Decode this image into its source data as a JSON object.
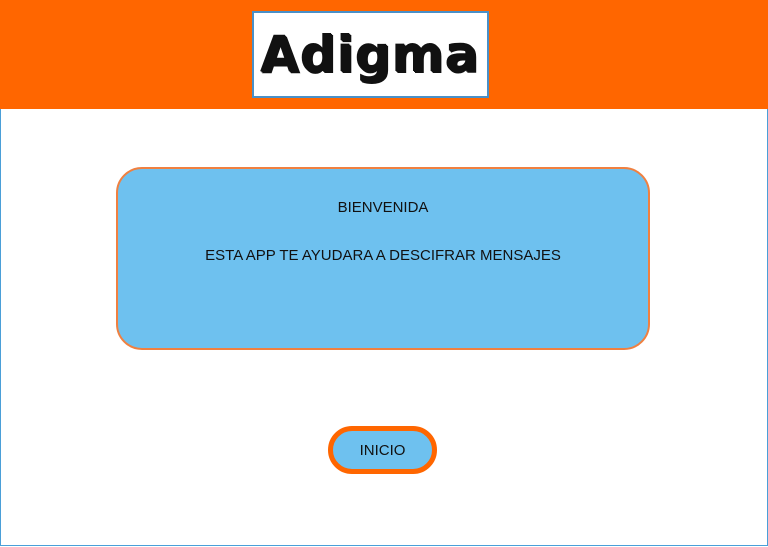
{
  "header": {
    "logo_text": "Adigma"
  },
  "welcome": {
    "title": "BIENVENIDA",
    "message": "ESTA APP TE AYUDARA A DESCIFRAR MENSAJES"
  },
  "actions": {
    "start_label": "INICIO"
  },
  "colors": {
    "header": "#ff6600",
    "card": "#6ec1ef",
    "card_border": "#f08040",
    "button_border": "#ff6600"
  }
}
